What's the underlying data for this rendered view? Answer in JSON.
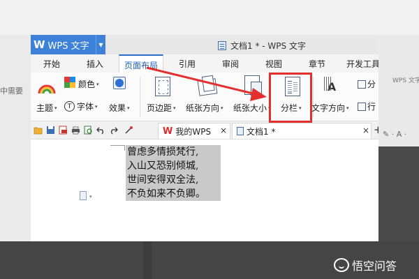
{
  "background": {
    "left_text": "中需要",
    "right_text": "WPS 文字",
    "right_tools": "✎ · A ·"
  },
  "titlebar": {
    "logo_letter": "W",
    "logo_label": "WPS 文字",
    "logo_dropdown": "▼",
    "document_title": "文档1 * - WPS 文字"
  },
  "menu": {
    "items": [
      "开始",
      "插入",
      "页面布局",
      "引用",
      "审阅",
      "视图",
      "章节",
      "开发工具"
    ],
    "active": "页面布局"
  },
  "ribbon": {
    "theme_label": "主题",
    "colors_label": "颜色",
    "font_label": "字体",
    "font_glyph": "T",
    "effect_label": "效果",
    "margins_label": "页边距",
    "orientation_label": "纸张方向",
    "size_label": "纸张大小",
    "columns_label": "分栏",
    "text_direction_label": "文字方向",
    "partial_right_top": "分",
    "partial_right_bottom": "行",
    "dropdown_glyph": "▾",
    "tdir_glyph": "A"
  },
  "quickbar": {
    "tabs": [
      {
        "label": "我的WPS",
        "close": "×"
      },
      {
        "label": "文档1 *",
        "close": "×"
      }
    ],
    "new_tab": "+",
    "wps_mark": "W"
  },
  "document": {
    "lines": [
      "曾虑多情损梵行,",
      "入山又恐别倾城,",
      "世间安得双全法,",
      "不负如来不负卿。"
    ]
  },
  "watermark": {
    "text": "悟空问答"
  },
  "colors": {
    "accent": "#3d82d8",
    "highlight": "#e3302f",
    "selection": "#c9c9c9"
  }
}
